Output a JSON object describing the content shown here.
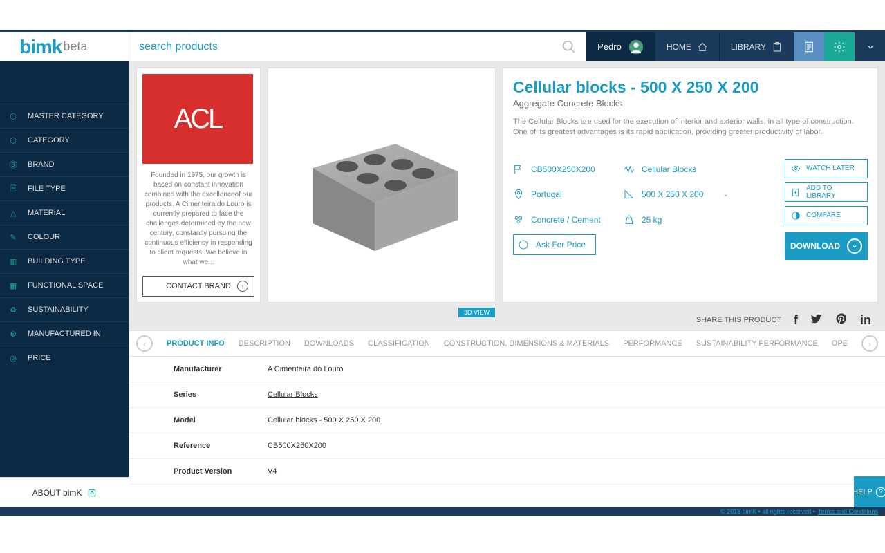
{
  "logo": {
    "main": "bimk",
    "sub": "beta"
  },
  "search": {
    "placeholder": "search products"
  },
  "user": {
    "name": "Pedro"
  },
  "nav": {
    "home": "HOME",
    "library": "LIBRARY"
  },
  "sidebar": {
    "items": [
      "MASTER CATEGORY",
      "CATEGORY",
      "BRAND",
      "FILE TYPE",
      "MATERIAL",
      "COLOUR",
      "BUILDING TYPE",
      "FUNCTIONAL SPACE",
      "SUSTAINABILITY",
      "MANUFACTURED IN",
      "PRICE"
    ],
    "about": "ABOUT bimK"
  },
  "brand": {
    "logo": "ACL",
    "desc": "Founded in 1975, our growth is based on constant innovation combined with the excellenceof our products. A Cimenteira do Louro is currently prepared to face the challenges determined by the new century, constantly pursuing the continuous efficiency in responding to client requests. We believe in what we...",
    "contact": "CONTACT BRAND"
  },
  "image": {
    "badge": "3D VIEW"
  },
  "product": {
    "title": "Cellular blocks - 500 X 250 X 200",
    "subtitle": "Aggregate Concrete Blocks",
    "desc": "The Cellular Blocks are used for the execution of interior and exterior walls, in all type of construction. One of its greatest advantages is its rapid application, providing greater productivity of labor."
  },
  "specs": {
    "ref": "CB500X250X200",
    "series": "Cellular Blocks",
    "country": "Portugal",
    "dims": "500 X 250 X 200",
    "material": "Concrete / Cement",
    "weight": "25 kg",
    "price": "Ask For Price"
  },
  "actions": {
    "watch": "WATCH LATER",
    "add": "ADD TO LIBRARY",
    "compare": "COMPARE",
    "download": "DOWNLOAD"
  },
  "share": {
    "label": "SHARE THIS PRODUCT"
  },
  "tabs": [
    "PRODUCT INFO",
    "DESCRIPTION",
    "DOWNLOADS",
    "CLASSIFICATION",
    "CONSTRUCTION, DIMENSIONS & MATERIALS",
    "PERFORMANCE",
    "SUSTAINABILITY PERFORMANCE",
    "OPERATIONS & MAINTENANCE"
  ],
  "table": [
    {
      "k": "Manufacturer",
      "v": "A Cimenteira do Louro",
      "link": false
    },
    {
      "k": "Series",
      "v": "Cellular Blocks",
      "link": true
    },
    {
      "k": "Model",
      "v": "Cellular blocks - 500 X 250 X 200",
      "link": false
    },
    {
      "k": "Reference",
      "v": "CB500X250X200",
      "link": false
    },
    {
      "k": "Product Version",
      "v": "V4",
      "link": false
    }
  ],
  "footer": {
    "copy": "© 2018 bimK • all rights reserved •",
    "terms": "Terms and Conditions"
  },
  "help": "HELP"
}
